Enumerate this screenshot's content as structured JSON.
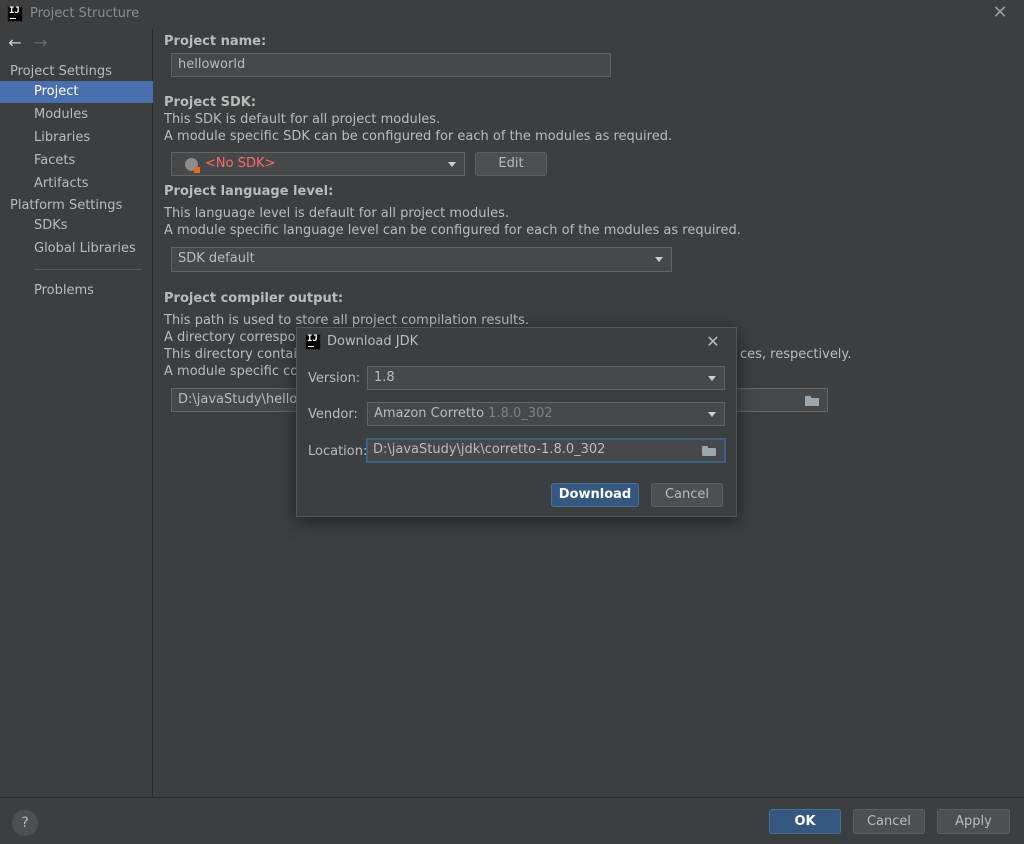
{
  "window": {
    "title": "Project Structure"
  },
  "sidebar": {
    "project_settings_header": "Project Settings",
    "project_items": [
      "Project",
      "Modules",
      "Libraries",
      "Facets",
      "Artifacts"
    ],
    "platform_settings_header": "Platform Settings",
    "platform_items": [
      "SDKs",
      "Global Libraries"
    ],
    "problems": "Problems",
    "selected": "Project"
  },
  "main": {
    "project_name_label": "Project name:",
    "project_name_value": "helloworld",
    "sdk_label": "Project SDK:",
    "sdk_desc1": "This SDK is default for all project modules.",
    "sdk_desc2": "A module specific SDK can be configured for each of the modules as required.",
    "sdk_value": "<No SDK>",
    "sdk_edit": "Edit",
    "lang_label": "Project language level:",
    "lang_desc1": "This language level is default for all project modules.",
    "lang_desc2": "A module specific language level can be configured for each of the modules as required.",
    "lang_value": "SDK default",
    "output_label": "Project compiler output:",
    "output_desc1": "This path is used to store all project compilation results.",
    "output_desc2": "A directory correspond",
    "output_desc3": "This directory contains",
    "output_desc3_tail": "ces, respectively.",
    "output_desc4": "A module specific com",
    "output_value": "D:\\javaStudy\\hellow"
  },
  "dialog": {
    "title": "Download JDK",
    "version_label": "Version:",
    "version_value": "1.8",
    "vendor_label": "Vendor:",
    "vendor_name": "Amazon Corretto",
    "vendor_version": "1.8.0_302",
    "location_label": "Location:",
    "location_value": "D:\\javaStudy\\jdk\\corretto-1.8.0_302",
    "download": "Download",
    "cancel": "Cancel"
  },
  "footer": {
    "help": "?",
    "ok": "OK",
    "cancel": "Cancel",
    "apply": "Apply"
  },
  "colors": {
    "background": "#3c3f41",
    "selection": "#4b6eaf",
    "primary_button": "#365880",
    "no_sdk": "#ff6b6b"
  }
}
